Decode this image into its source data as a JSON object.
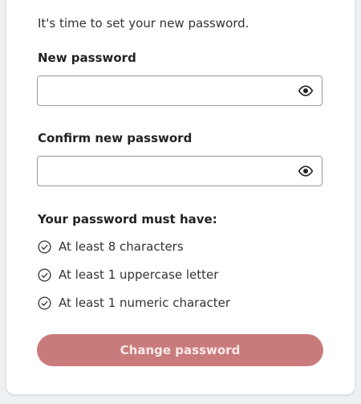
{
  "intro_text": "It's time to set your new password.",
  "new_password": {
    "label": "New password",
    "value": "",
    "reveal_icon": "eye-icon"
  },
  "confirm_password": {
    "label": "Confirm new password",
    "value": "",
    "reveal_icon": "eye-icon"
  },
  "requirements": {
    "title": "Your password must have:",
    "items": [
      {
        "text": "At least 8 characters",
        "icon": "check-circle-icon"
      },
      {
        "text": "At least 1 uppercase letter",
        "icon": "check-circle-icon"
      },
      {
        "text": "At least 1 numeric character",
        "icon": "check-circle-icon"
      }
    ]
  },
  "submit": {
    "label": "Change password",
    "background_color": "#c97b7b"
  }
}
